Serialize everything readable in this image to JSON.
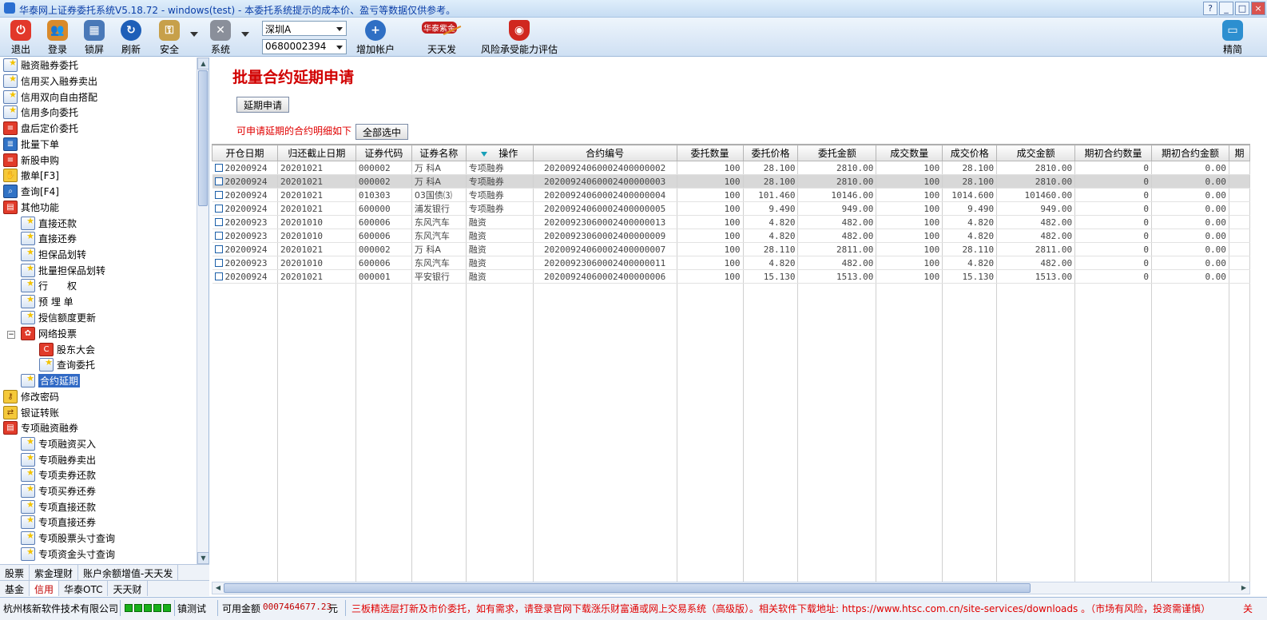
{
  "window": {
    "title": "华泰网上证券委托系统V5.18.72 - windows(test) - 本委托系统提示的成本价、盈亏等数据仅供参考。",
    "buttons": [
      "?",
      "_",
      "□",
      "×"
    ]
  },
  "toolbar": {
    "exit": "退出",
    "login": "登录",
    "lock": "锁屏",
    "refresh": "刷新",
    "security": "安全",
    "system": "系统",
    "market_select": "深圳A",
    "account_select": "0680002394",
    "add_account": "增加帐户",
    "tiantianfa_badge": "华泰紫金",
    "tiantianfa": "天天发",
    "risk": "风险承受能力评估",
    "simple": "精简"
  },
  "sidebar": {
    "items": [
      {
        "label": "融资融券委托"
      },
      {
        "label": "信用买入融券卖出"
      },
      {
        "label": "信用双向自由搭配"
      },
      {
        "label": "信用多向委托"
      },
      {
        "label": "盘后定价委托"
      },
      {
        "label": "批量下单"
      },
      {
        "label": "新股申购"
      },
      {
        "label": "撤单[F3]"
      },
      {
        "label": "查询[F4]"
      },
      {
        "label": "其他功能"
      },
      {
        "label": "直接还款"
      },
      {
        "label": "直接还券"
      },
      {
        "label": "担保品划转"
      },
      {
        "label": "批量担保品划转"
      },
      {
        "label": "行　　权"
      },
      {
        "label": "预 埋 单"
      },
      {
        "label": "授信额度更新"
      },
      {
        "label": "网络投票"
      },
      {
        "label": "股东大会"
      },
      {
        "label": "查询委托"
      },
      {
        "label": "合约延期"
      },
      {
        "label": "修改密码"
      },
      {
        "label": "银证转账"
      },
      {
        "label": "专项融资融券"
      },
      {
        "label": "专项融资买入"
      },
      {
        "label": "专项融券卖出"
      },
      {
        "label": "专项卖券还款"
      },
      {
        "label": "专项买券还券"
      },
      {
        "label": "专项直接还款"
      },
      {
        "label": "专项直接还券"
      },
      {
        "label": "专项股票头寸查询"
      },
      {
        "label": "专项资金头寸查询"
      }
    ],
    "tabs_row1": [
      "股票",
      "紫金理财",
      "账户余额增值-天天发"
    ],
    "tabs_row2": [
      "基金",
      "信用",
      "华泰OTC",
      "天天财"
    ]
  },
  "main": {
    "title": "批量合约延期申请",
    "apply_button": "延期申请",
    "hint": "可申请延期的合约明细如下",
    "select_all_button": "全部选中",
    "columns": [
      "开仓日期",
      "归还截止日期",
      "证券代码",
      "证券名称",
      "操作",
      "合约编号",
      "委托数量",
      "委托价格",
      "委托金额",
      "成交数量",
      "成交价格",
      "成交金额",
      "期初合约数量",
      "期初合约金额",
      "期"
    ],
    "rows": [
      [
        "20200924",
        "20201021",
        "000002",
        "万 科A",
        "专项融券",
        "20200924060002400000002",
        "100",
        "28.100",
        "2810.00",
        "100",
        "28.100",
        "2810.00",
        "0",
        "0.00"
      ],
      [
        "20200924",
        "20201021",
        "000002",
        "万 科A",
        "专项融券",
        "20200924060002400000003",
        "100",
        "28.100",
        "2810.00",
        "100",
        "28.100",
        "2810.00",
        "0",
        "0.00"
      ],
      [
        "20200924",
        "20201021",
        "010303",
        "03国债⑶",
        "专项融券",
        "20200924060002400000004",
        "100",
        "101.460",
        "10146.00",
        "100",
        "1014.600",
        "101460.00",
        "0",
        "0.00"
      ],
      [
        "20200924",
        "20201021",
        "600000",
        "浦发银行",
        "专项融券",
        "20200924060002400000005",
        "100",
        "9.490",
        "949.00",
        "100",
        "9.490",
        "949.00",
        "0",
        "0.00"
      ],
      [
        "20200923",
        "20201010",
        "600006",
        "东风汽车",
        "融资",
        "20200923060002400000013",
        "100",
        "4.820",
        "482.00",
        "100",
        "4.820",
        "482.00",
        "0",
        "0.00"
      ],
      [
        "20200923",
        "20201010",
        "600006",
        "东风汽车",
        "融资",
        "20200923060002400000009",
        "100",
        "4.820",
        "482.00",
        "100",
        "4.820",
        "482.00",
        "0",
        "0.00"
      ],
      [
        "20200924",
        "20201021",
        "000002",
        "万 科A",
        "融资",
        "20200924060002400000007",
        "100",
        "28.110",
        "2811.00",
        "100",
        "28.110",
        "2811.00",
        "0",
        "0.00"
      ],
      [
        "20200923",
        "20201010",
        "600006",
        "东风汽车",
        "融资",
        "20200923060002400000011",
        "100",
        "4.820",
        "482.00",
        "100",
        "4.820",
        "482.00",
        "0",
        "0.00"
      ],
      [
        "20200924",
        "20201021",
        "000001",
        "平安银行",
        "融资",
        "20200924060002400000006",
        "100",
        "15.130",
        "1513.00",
        "100",
        "15.130",
        "1513.00",
        "0",
        "0.00"
      ]
    ],
    "selected_row": 1
  },
  "statusbar": {
    "company": "杭州核新软件技术有限公司",
    "env": "镇测试",
    "available_label": "可用金额",
    "available_value": "0007464677.23",
    "currency": "元",
    "ticker": "三板精选层打新及市价委托，如有需求，请登录官网下载涨乐财富通或网上交易系统（高级版）。相关软件下载地址: https://www.htsc.com.cn/site-services/downloads 。（市场有风险，投资需谨慎）",
    "tail": "关"
  }
}
